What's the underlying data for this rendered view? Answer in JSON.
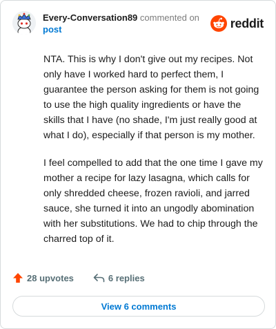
{
  "comment": {
    "author": "Every-Conversation89",
    "action_text": "commented on",
    "target_text": "post",
    "paragraphs": [
      "NTA. This is why I don't give out my recipes. Not only have I worked hard to perfect them, I guarantee the person asking for them is not going to use the high quality ingredients or have the skills that I have (no shade, I'm just really good at what I do), especially if that person is my mother.",
      "I feel compelled to add that the one time I gave my mother a recipe for lazy lasagna, which calls for only shredded cheese, frozen ravioli, and jarred sauce, she turned it into an ungodly abomination with her substitutions. We had to chip through the charred top of it."
    ],
    "upvotes_label": "28 upvotes",
    "replies_label": "6 replies",
    "view_comments_label": "View 6 comments"
  },
  "brand": {
    "name": "reddit",
    "icon": "reddit-logo-icon"
  },
  "colors": {
    "brand_orange": "#ff4500",
    "link_blue": "#0079d3",
    "meta_gray": "#576f76"
  },
  "icons": {
    "upvote": "upvote-arrow-icon",
    "reply": "reply-arrow-icon",
    "avatar": "snoo-avatar-icon"
  }
}
